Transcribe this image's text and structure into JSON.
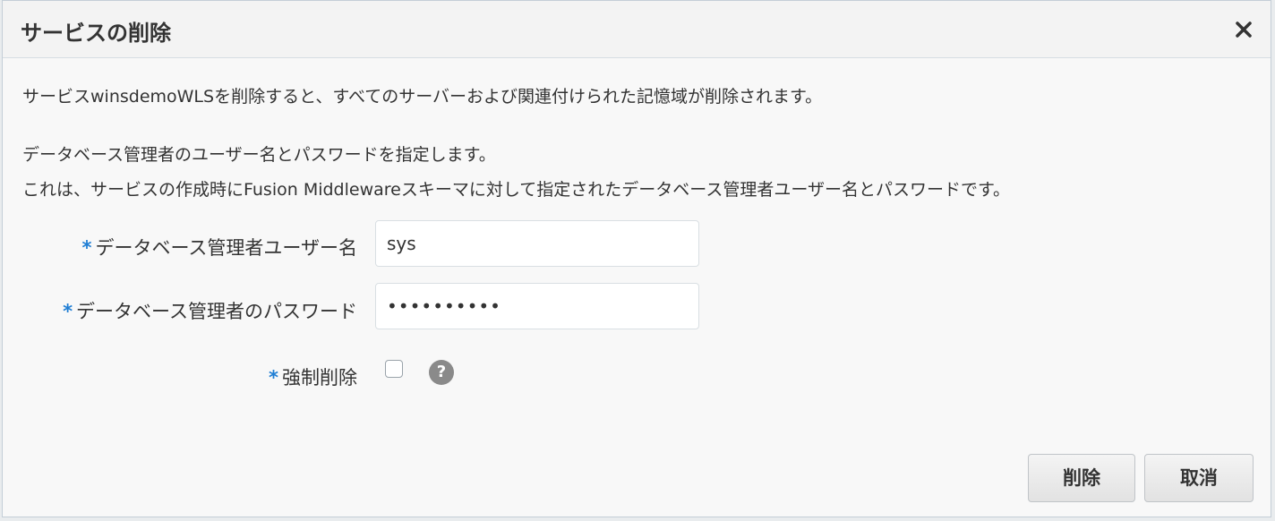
{
  "dialog": {
    "title": "サービスの削除",
    "close_icon": "close-icon"
  },
  "messages": {
    "line1": "サービスwinsdemoWLSを削除すると、すべてのサーバーおよび関連付けられた記憶域が削除されます。",
    "line2": "データベース管理者のユーザー名とパスワードを指定します。",
    "line3": "これは、サービスの作成時にFusion Middlewareスキーマに対して指定されたデータベース管理者ユーザー名とパスワードです。"
  },
  "form": {
    "required_marker": "*",
    "username_label": "データベース管理者ユーザー名",
    "username_value": "sys",
    "password_label": "データベース管理者のパスワード",
    "password_value": "••••••••••",
    "force_label": "強制削除",
    "force_checked": false,
    "help_icon": "question-circle-icon",
    "help_symbol": "?"
  },
  "buttons": {
    "delete_label": "削除",
    "cancel_label": "取消"
  },
  "colors": {
    "required": "#1f7ed4",
    "help_icon": "#8a8a8a"
  }
}
